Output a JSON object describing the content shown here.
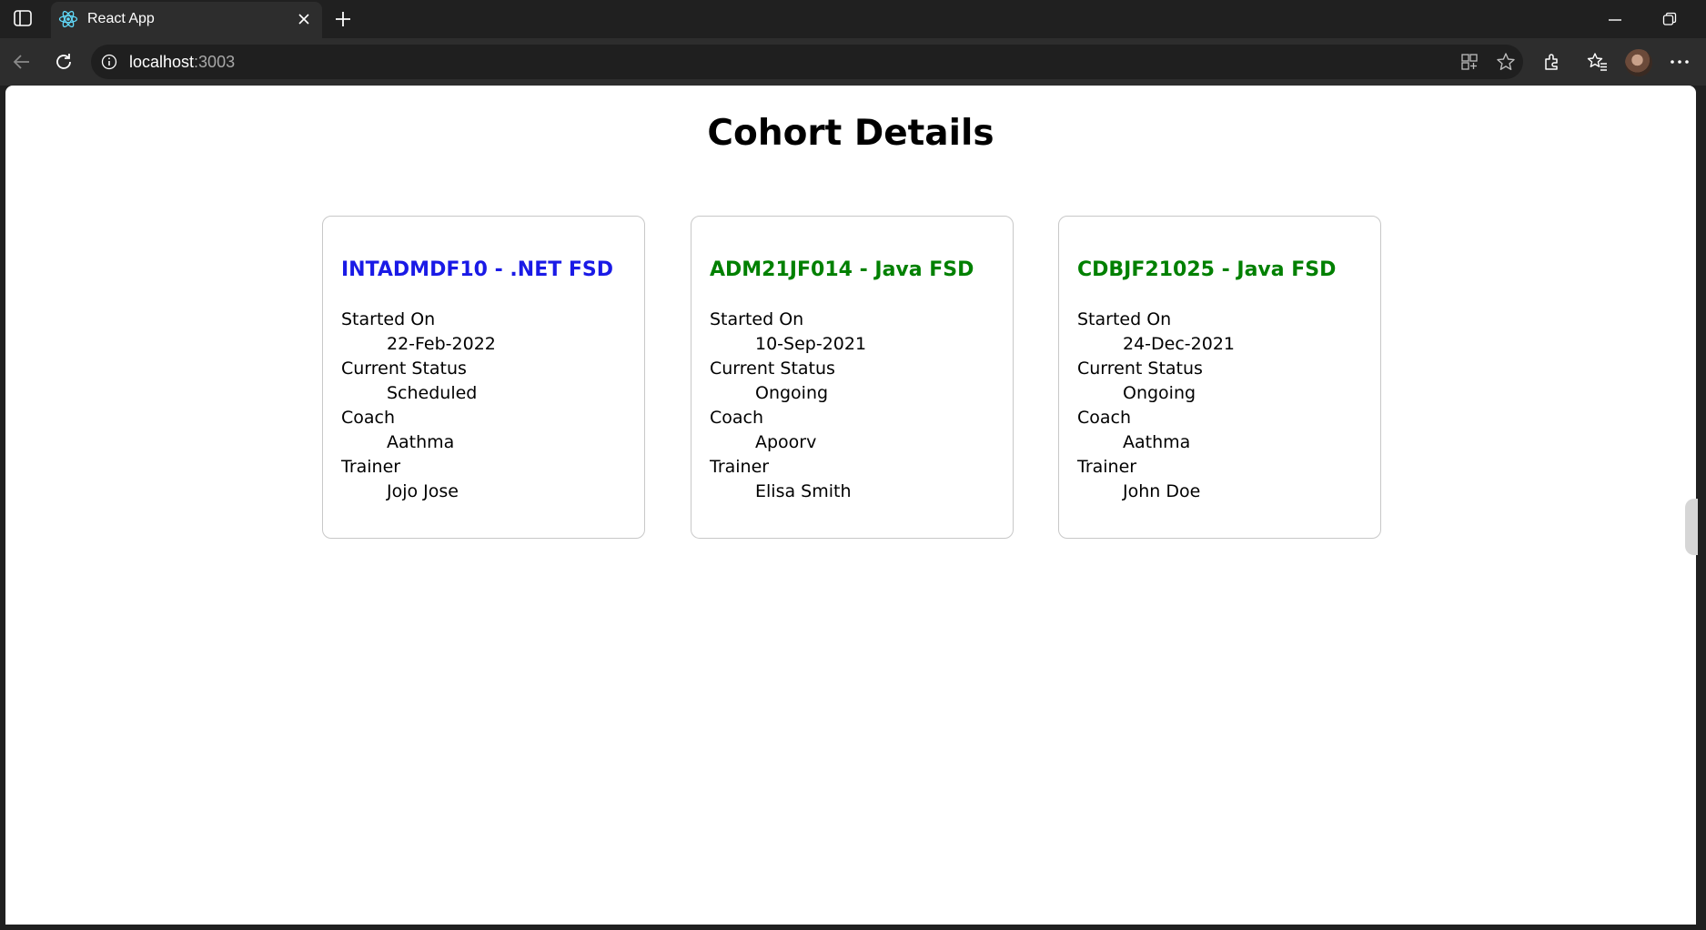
{
  "browser": {
    "tab": {
      "title": "React App"
    },
    "address": {
      "host": "localhost",
      "port": ":3003"
    }
  },
  "page": {
    "title": "Cohort Details",
    "cohorts": [
      {
        "name": "INTADMDF10 - .NET FSD",
        "title_color": "#1a1ae6",
        "fields": [
          {
            "label": "Started On",
            "value": "22-Feb-2022"
          },
          {
            "label": "Current Status",
            "value": "Scheduled"
          },
          {
            "label": "Coach",
            "value": "Aathma"
          },
          {
            "label": "Trainer",
            "value": "Jojo Jose"
          }
        ]
      },
      {
        "name": "ADM21JF014 - Java FSD",
        "title_color": "#008000",
        "fields": [
          {
            "label": "Started On",
            "value": "10-Sep-2021"
          },
          {
            "label": "Current Status",
            "value": "Ongoing"
          },
          {
            "label": "Coach",
            "value": "Apoorv"
          },
          {
            "label": "Trainer",
            "value": "Elisa Smith"
          }
        ]
      },
      {
        "name": "CDBJF21025 - Java FSD",
        "title_color": "#008000",
        "fields": [
          {
            "label": "Started On",
            "value": "24-Dec-2021"
          },
          {
            "label": "Current Status",
            "value": "Ongoing"
          },
          {
            "label": "Coach",
            "value": "Aathma"
          },
          {
            "label": "Trainer",
            "value": "John Doe"
          }
        ]
      }
    ]
  }
}
